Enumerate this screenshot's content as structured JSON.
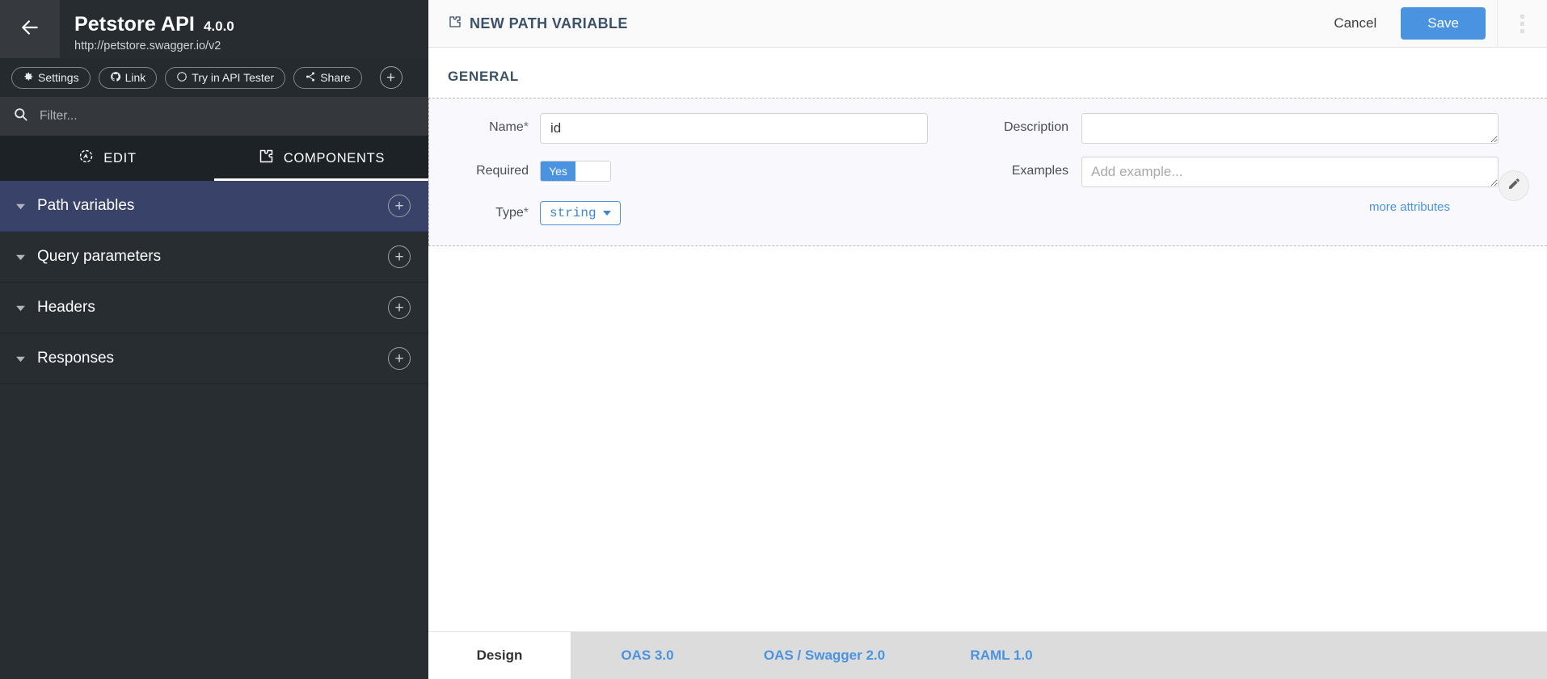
{
  "sidebar": {
    "back_icon": "arrow-left-icon",
    "title": "Petstore API",
    "version": "4.0.0",
    "url": "http://petstore.swagger.io/v2",
    "toolbar": {
      "settings_label": "Settings",
      "link_label": "Link",
      "try_label": "Try in API Tester",
      "share_label": "Share",
      "add_label": "+"
    },
    "filter": {
      "placeholder": "Filter...",
      "value": "",
      "icon": "search-icon"
    },
    "tabs": [
      {
        "label": "EDIT",
        "icon": "compass-icon",
        "active": false
      },
      {
        "label": "COMPONENTS",
        "icon": "puzzle-piece-icon",
        "active": true
      }
    ],
    "tree": [
      {
        "label": "Path variables",
        "selected": true,
        "add": "+"
      },
      {
        "label": "Query parameters",
        "selected": false,
        "add": "+"
      },
      {
        "label": "Headers",
        "selected": false,
        "add": "+"
      },
      {
        "label": "Responses",
        "selected": false,
        "add": "+"
      }
    ]
  },
  "main": {
    "header": {
      "icon": "puzzle-piece-icon",
      "title": "NEW PATH VARIABLE",
      "cancel_label": "Cancel",
      "save_label": "Save",
      "kebab_icon": "more-vertical-icon",
      "save_color": "#4a93e0"
    },
    "section_title": "GENERAL",
    "fields": {
      "name_label": "Name",
      "name_required_mark": "*",
      "name_value": "id",
      "required_label": "Required",
      "required_toggle_on_label": "Yes",
      "type_label": "Type",
      "type_required_mark": "*",
      "type_value": "string",
      "description_label": "Description",
      "description_value": "",
      "description_placeholder": "",
      "examples_label": "Examples",
      "examples_value": "",
      "examples_placeholder": "Add example...",
      "more_attributes_label": "more attributes"
    },
    "edit_button_icon": "pencil-icon"
  },
  "bottom_tabs": [
    {
      "label": "Design",
      "active": true
    },
    {
      "label": "OAS 3.0",
      "active": false
    },
    {
      "label": "OAS / Swagger 2.0",
      "active": false
    },
    {
      "label": "RAML 1.0",
      "active": false
    }
  ]
}
